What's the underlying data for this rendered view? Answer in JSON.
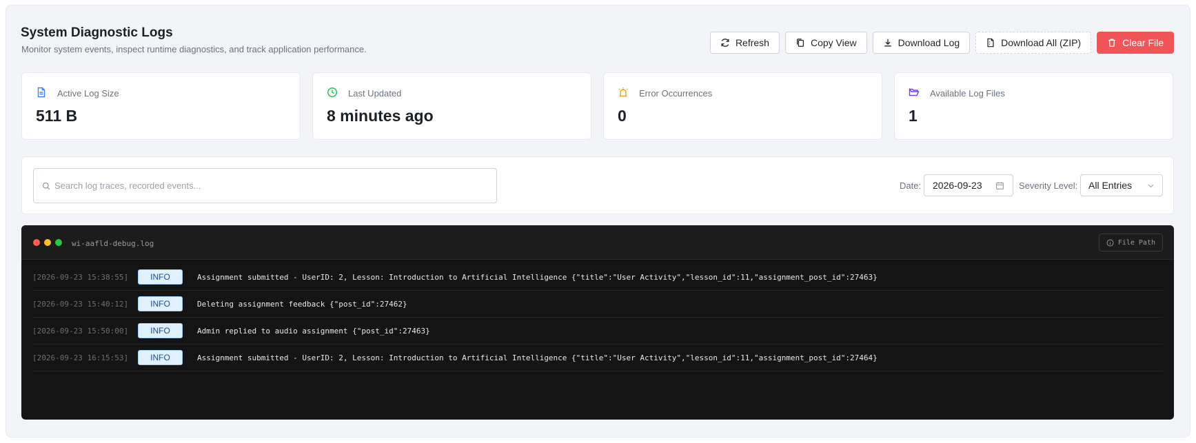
{
  "header": {
    "title": "System Diagnostic Logs",
    "subtitle": "Monitor system events, inspect runtime diagnostics, and track application performance."
  },
  "toolbar": {
    "refresh_label": "Refresh",
    "copy_label": "Copy View",
    "download_label": "Download Log",
    "download_all_label": "Download All (ZIP)",
    "clear_label": "Clear File"
  },
  "stats": [
    {
      "label": "Active Log Size",
      "value": "511 B",
      "icon": "file-text-icon",
      "color": "#3b82f6"
    },
    {
      "label": "Last Updated",
      "value": "8 minutes ago",
      "icon": "clock-icon",
      "color": "#22c55e"
    },
    {
      "label": "Error Occurrences",
      "value": "0",
      "icon": "alarm-icon",
      "color": "#f59e0b"
    },
    {
      "label": "Available Log Files",
      "value": "1",
      "icon": "folder-open-icon",
      "color": "#7c3aed"
    }
  ],
  "filters": {
    "search_placeholder": "Search log traces, recorded events...",
    "date_label": "Date:",
    "date_value": "2026-09-23",
    "severity_label": "Severity Level:",
    "severity_value": "All Entries"
  },
  "terminal": {
    "file_name": "wi-aafld-debug.log",
    "file_path_label": "File Path",
    "rows": [
      {
        "timestamp": "[2026-09-23 15:38:55]",
        "level": "INFO",
        "message": "Assignment submitted - UserID: 2, Lesson: Introduction to Artificial Intelligence {\"title\":\"User Activity\",\"lesson_id\":11,\"assignment_post_id\":27463}"
      },
      {
        "timestamp": "[2026-09-23 15:40:12]",
        "level": "INFO",
        "message": "Deleting assignment feedback {\"post_id\":27462}"
      },
      {
        "timestamp": "[2026-09-23 15:50:00]",
        "level": "INFO",
        "message": "Admin replied to audio assignment {\"post_id\":27463}"
      },
      {
        "timestamp": "[2026-09-23 16:15:53]",
        "level": "INFO",
        "message": "Assignment submitted - UserID: 2, Lesson: Introduction to Artificial Intelligence {\"title\":\"User Activity\",\"lesson_id\":11,\"assignment_post_id\":27464}"
      }
    ]
  },
  "colors": {
    "danger": "#f25457",
    "dot_red": "#ff5f57",
    "dot_yellow": "#febc2e",
    "dot_green": "#28c840"
  }
}
